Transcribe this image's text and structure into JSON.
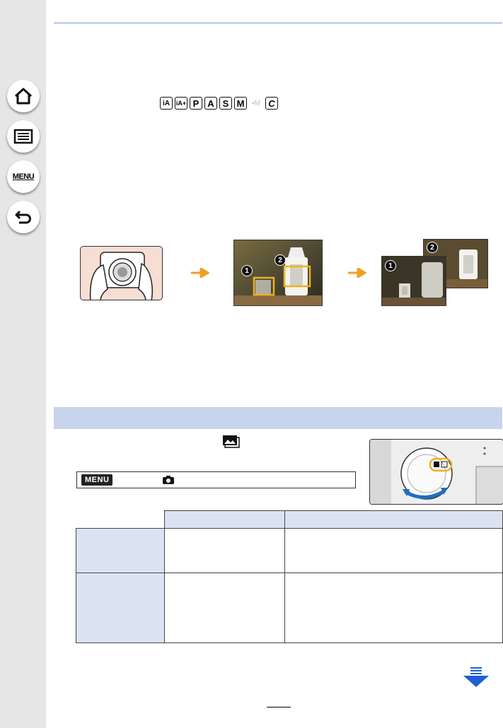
{
  "sidebar": {
    "buttons": [
      {
        "name": "home",
        "icon": "home-icon"
      },
      {
        "name": "contents",
        "icon": "list-icon"
      },
      {
        "name": "menu",
        "icon": "menu-text-icon",
        "label": "MENU"
      },
      {
        "name": "back",
        "icon": "back-arrow-icon"
      }
    ]
  },
  "modes": {
    "items": [
      "iA",
      "iA+",
      "P",
      "A",
      "S",
      "M",
      "•M",
      "C"
    ]
  },
  "illustration": {
    "markers": [
      "1",
      "2"
    ]
  },
  "menu_path": {
    "badge": "MENU"
  },
  "colors": {
    "accent_blue": "#c8d3ec",
    "arrow_orange": "#f0a020",
    "focus_frame": "#f0b020",
    "next_arrow": "#1e5fd0"
  }
}
